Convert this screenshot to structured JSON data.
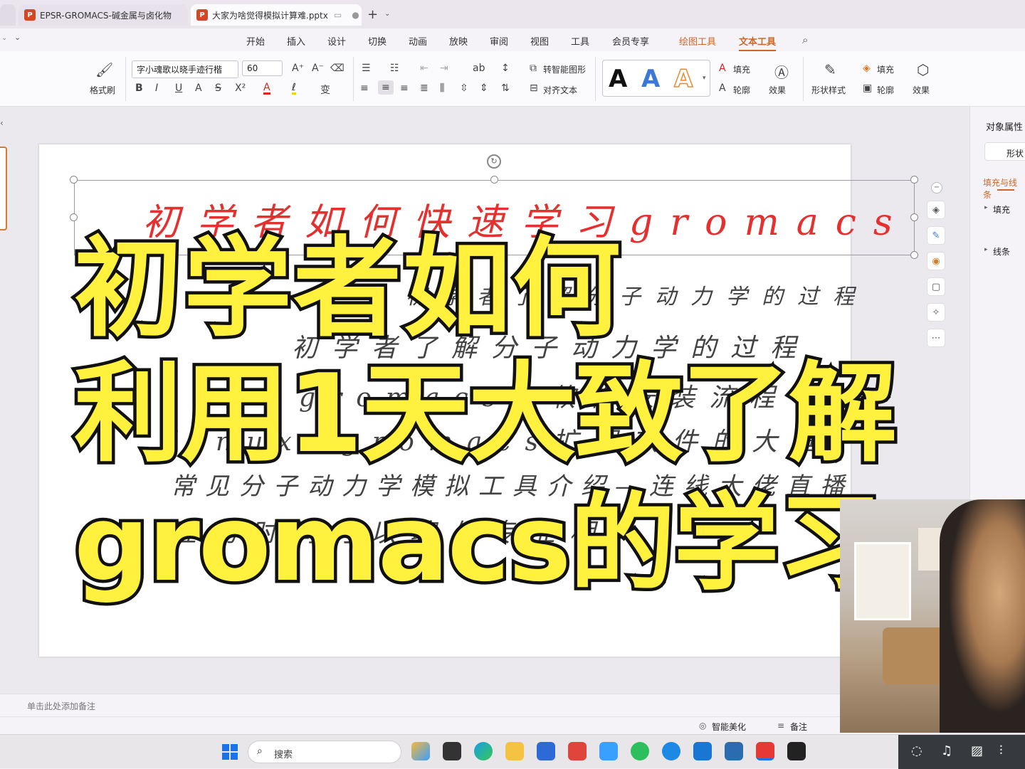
{
  "tabs": [
    {
      "label": "EPSR-GROMACS-碱金属与卤化物",
      "active": false
    },
    {
      "label": "大家为啥觉得模拟计算难.pptx",
      "active": true
    }
  ],
  "menu": [
    "开始",
    "插入",
    "设计",
    "切换",
    "动画",
    "放映",
    "审阅",
    "视图",
    "工具",
    "会员专享",
    "绘图工具",
    "文本工具"
  ],
  "ribbon": {
    "format_painter": "格式刷",
    "font_name": "字小魂歌以晓手迹行楷",
    "font_size": "60",
    "smart_shape": "转智能图形",
    "align_text": "对齐文本",
    "fill": "填充",
    "outline": "轮廓",
    "effect": "效果",
    "shape_style": "形状样式",
    "fill2": "填充",
    "outline2": "轮廓",
    "effect2": "效果",
    "text_styles": [
      "A",
      "A",
      "A"
    ]
  },
  "right_panel": {
    "title": "对象属性",
    "tab": "形状",
    "section": "填充与线条",
    "items": [
      "填充",
      "线条"
    ]
  },
  "slide": {
    "handwritten_title": "初学者如何快速学习gromacs",
    "handwritten_lines": [
      "初学者了解分子动力学的过程",
      "gromacs和软件安装流程",
      "linux+gromacs扩展软件的大框",
      "常见分子动力学模拟工具介绍—连线大佬直播",
      "互动时间可以聊与专业相关"
    ],
    "overlay_lines": [
      "初学者如何",
      "利用1天大致了解",
      "gromacs的学习"
    ]
  },
  "notes_placeholder": "单击此处添加备注",
  "status": {
    "beautify": "智能美化",
    "notes": "备注"
  },
  "taskbar": {
    "search": "搜索"
  },
  "colors": {
    "overlay_fill": "#fff13d",
    "overlay_stroke": "#111111",
    "title_red": "#e53030",
    "accent": "#d24726"
  }
}
